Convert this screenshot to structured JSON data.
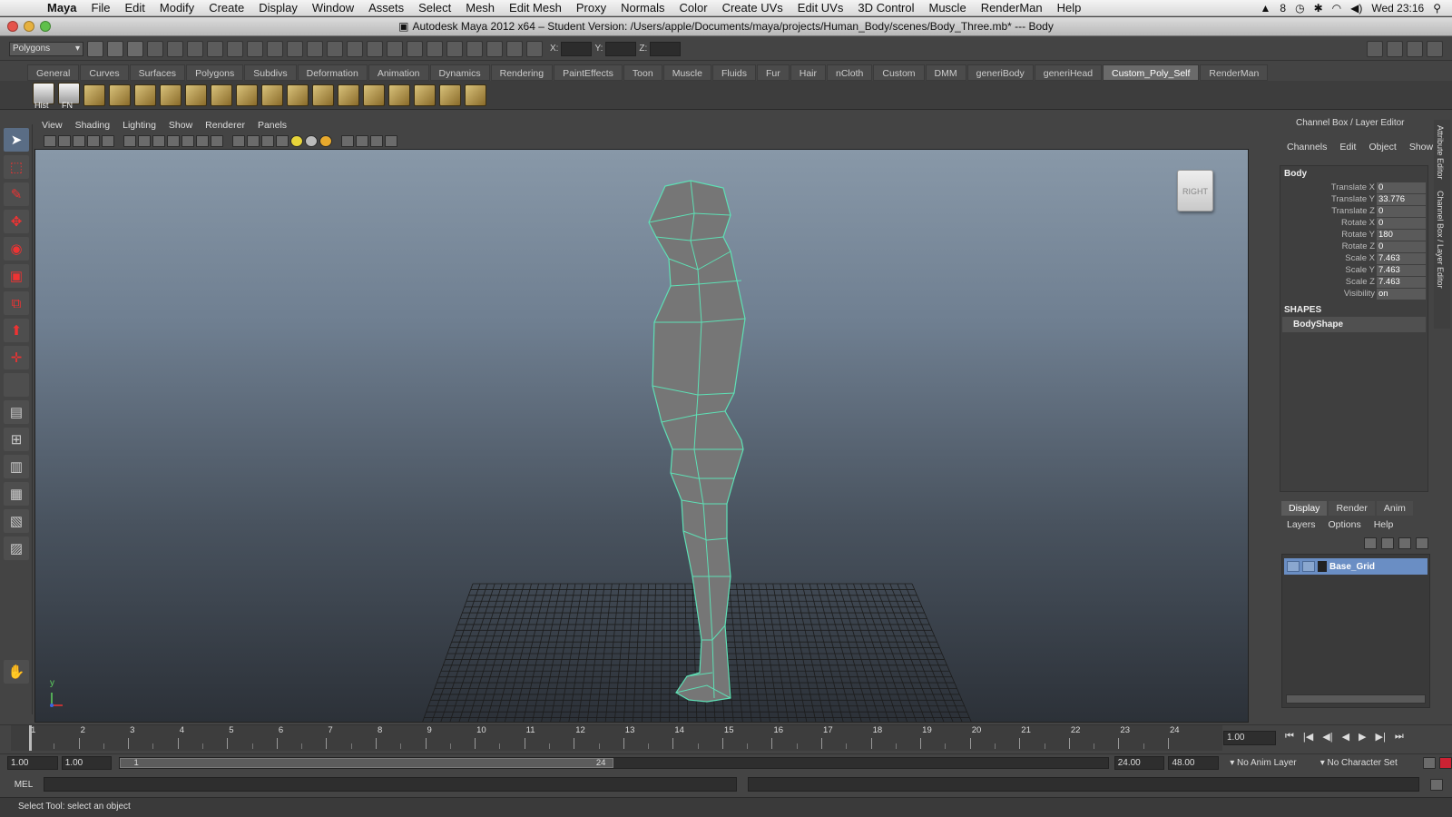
{
  "menubar": {
    "app_name": "Maya",
    "items": [
      "File",
      "Edit",
      "Modify",
      "Create",
      "Display",
      "Window",
      "Assets",
      "Select",
      "Mesh",
      "Edit Mesh",
      "Proxy",
      "Normals",
      "Color",
      "Create UVs",
      "Edit UVs",
      "3D Control",
      "Muscle",
      "RenderMan",
      "Help"
    ],
    "status_number": "8",
    "clock": "Wed 23:16"
  },
  "window": {
    "title": "Autodesk Maya 2012 x64 – Student Version: /Users/apple/Documents/maya/projects/Human_Body/scenes/Body_Three.mb*  ---  Body"
  },
  "statusline": {
    "mode": "Polygons",
    "x_label": "X:",
    "y_label": "Y:",
    "z_label": "Z:"
  },
  "shelf": {
    "tabs": [
      "General",
      "Curves",
      "Surfaces",
      "Polygons",
      "Subdivs",
      "Deformation",
      "Animation",
      "Dynamics",
      "Rendering",
      "PaintEffects",
      "Toon",
      "Muscle",
      "Fluids",
      "Fur",
      "Hair",
      "nCloth",
      "Custom",
      "DMM",
      "generiBody",
      "generiHead",
      "Custom_Poly_Self",
      "RenderMan"
    ],
    "active_tab": "Custom_Poly_Self",
    "hist_label": "Hist",
    "fn_label": "FN"
  },
  "viewport": {
    "menu": [
      "View",
      "Shading",
      "Lighting",
      "Show",
      "Renderer",
      "Panels"
    ],
    "viewcube_label": "RIGHT",
    "axis_label": "y"
  },
  "channelbox": {
    "title": "Channel Box / Layer Editor",
    "menu": [
      "Channels",
      "Edit",
      "Object",
      "Show"
    ],
    "object_name": "Body",
    "attributes": [
      {
        "name": "Translate X",
        "value": "0"
      },
      {
        "name": "Translate Y",
        "value": "33.776"
      },
      {
        "name": "Translate Z",
        "value": "0"
      },
      {
        "name": "Rotate X",
        "value": "0"
      },
      {
        "name": "Rotate Y",
        "value": "180"
      },
      {
        "name": "Rotate Z",
        "value": "0"
      },
      {
        "name": "Scale X",
        "value": "7.463"
      },
      {
        "name": "Scale Y",
        "value": "7.463"
      },
      {
        "name": "Scale Z",
        "value": "7.463"
      },
      {
        "name": "Visibility",
        "value": "on"
      }
    ],
    "shapes_title": "SHAPES",
    "shape_name": "BodyShape",
    "side_tabs": [
      "Attribute Editor",
      "Channel Box / Layer Editor"
    ]
  },
  "layer_editor": {
    "tabs": [
      "Display",
      "Render",
      "Anim"
    ],
    "active_tab": "Display",
    "menu": [
      "Layers",
      "Options",
      "Help"
    ],
    "layers": [
      "Base_Grid"
    ]
  },
  "timeslider": {
    "ticks": [
      "1",
      "2",
      "3",
      "4",
      "5",
      "6",
      "7",
      "8",
      "9",
      "10",
      "11",
      "12",
      "13",
      "14",
      "15",
      "16",
      "17",
      "18",
      "19",
      "20",
      "21",
      "22",
      "23",
      "24"
    ],
    "current_frame": "1.00"
  },
  "rangeslider": {
    "start": "1.00",
    "anim_start": "1.00",
    "range_start_label": "1",
    "range_end_label": "24",
    "anim_end": "24.00",
    "end": "48.00",
    "anim_layer": "No Anim Layer",
    "character_set": "No Character Set"
  },
  "cmdline": {
    "label": "MEL"
  },
  "helpline": {
    "text": "Select Tool: select an object"
  }
}
